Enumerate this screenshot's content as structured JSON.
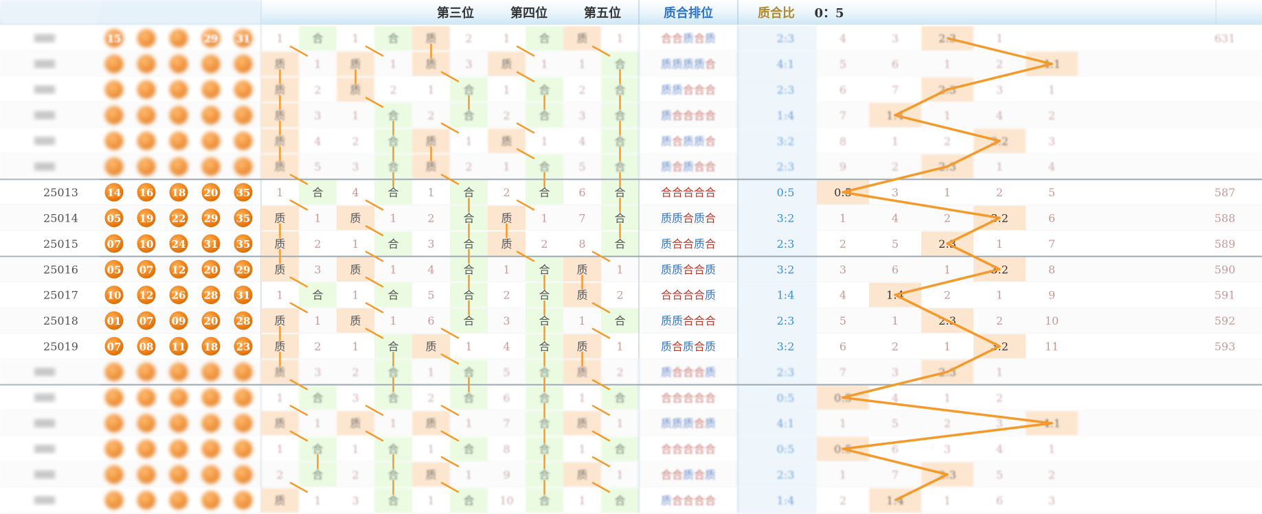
{
  "header": {
    "labels": [
      {
        "id": "col-pos3",
        "text": "第三位"
      },
      {
        "id": "col-pos4",
        "text": "第四位"
      },
      {
        "id": "col-pos5",
        "text": "第五位"
      },
      {
        "id": "col-order",
        "text": "质合排位"
      },
      {
        "id": "col-ratio",
        "text": "质合比"
      },
      {
        "id": "col-ratio-current",
        "text": "0：5"
      }
    ]
  },
  "colors": {
    "zhi_bg": "#fde6d0",
    "he_bg": "#eafbe2",
    "zhi_text": "#555555",
    "he_text": "#555555",
    "miss_text": "#c79a9a",
    "ratio_text": "#3a8fcc",
    "order_zhi": "#2f74c9",
    "order_he": "#c0392b",
    "ball": "#f0841c",
    "line": "#f39a2b",
    "pivot_bg": "#fde6d0"
  },
  "ratio_keys": [
    "0:5",
    "1:4",
    "2:3",
    "3:2",
    "4:1"
  ],
  "rows": [
    {
      "issue": "",
      "balls": [
        "15",
        "",
        "",
        "29",
        "31"
      ],
      "pos": [
        [
          "M",
          "1"
        ],
        [
          "H",
          ""
        ],
        [
          "M",
          "1"
        ],
        [
          "H",
          ""
        ],
        [
          "Z",
          ""
        ],
        [
          "M",
          "2"
        ],
        [
          "M",
          "1"
        ],
        [
          "H",
          ""
        ],
        [
          "Z",
          ""
        ],
        [
          "M",
          "1"
        ]
      ],
      "order": "合合质合质",
      "ratio": "2:3",
      "miss": [
        "4",
        "3",
        "2:3",
        "1",
        "",
        "631"
      ],
      "blur": "hard"
    },
    {
      "issue": "",
      "balls": [
        "",
        "",
        "",
        "",
        ""
      ],
      "pos": [
        [
          "Z",
          ""
        ],
        [
          "M",
          "1"
        ],
        [
          "Z",
          ""
        ],
        [
          "M",
          "1"
        ],
        [
          "Z",
          ""
        ],
        [
          "M",
          "3"
        ],
        [
          "Z",
          ""
        ],
        [
          "M",
          "1"
        ],
        [
          "M",
          "1"
        ],
        [
          "H",
          ""
        ]
      ],
      "order": "质质质质合",
      "ratio": "4:1",
      "miss": [
        "5",
        "6",
        "1",
        "2",
        "4:1",
        ""
      ],
      "blur": "hard"
    },
    {
      "issue": "",
      "balls": [
        "",
        "",
        "",
        "",
        ""
      ],
      "pos": [
        [
          "Z",
          ""
        ],
        [
          "M",
          "2"
        ],
        [
          "Z",
          ""
        ],
        [
          "M",
          "2"
        ],
        [
          "M",
          "1"
        ],
        [
          "H",
          ""
        ],
        [
          "M",
          "1"
        ],
        [
          "H",
          ""
        ],
        [
          "M",
          "2"
        ],
        [
          "H",
          ""
        ]
      ],
      "order": "质质合合合",
      "ratio": "2:3",
      "miss": [
        "6",
        "7",
        "2:3",
        "3",
        "1",
        ""
      ],
      "blur": "hard"
    },
    {
      "issue": "",
      "balls": [
        "",
        "",
        "",
        "",
        ""
      ],
      "pos": [
        [
          "Z",
          ""
        ],
        [
          "M",
          "3"
        ],
        [
          "M",
          "1"
        ],
        [
          "H",
          ""
        ],
        [
          "M",
          "2"
        ],
        [
          "H",
          ""
        ],
        [
          "M",
          "2"
        ],
        [
          "H",
          ""
        ],
        [
          "M",
          "3"
        ],
        [
          "H",
          ""
        ]
      ],
      "order": "质合合合合",
      "ratio": "1:4",
      "miss": [
        "7",
        "1:4",
        "1",
        "4",
        "2",
        ""
      ],
      "blur": "hard"
    },
    {
      "issue": "",
      "balls": [
        "",
        "",
        "",
        "",
        ""
      ],
      "pos": [
        [
          "Z",
          ""
        ],
        [
          "M",
          "4"
        ],
        [
          "M",
          "2"
        ],
        [
          "H",
          ""
        ],
        [
          "Z",
          ""
        ],
        [
          "M",
          "1"
        ],
        [
          "Z",
          ""
        ],
        [
          "M",
          "1"
        ],
        [
          "M",
          "4"
        ],
        [
          "H",
          ""
        ]
      ],
      "order": "质合质质合",
      "ratio": "3:2",
      "miss": [
        "8",
        "1",
        "2",
        "3:2",
        "3",
        ""
      ],
      "blur": "hard"
    },
    {
      "issue": "",
      "balls": [
        "",
        "",
        "",
        "",
        ""
      ],
      "pos": [
        [
          "Z",
          ""
        ],
        [
          "M",
          "5"
        ],
        [
          "M",
          "3"
        ],
        [
          "H",
          ""
        ],
        [
          "Z",
          ""
        ],
        [
          "M",
          "2"
        ],
        [
          "M",
          "1"
        ],
        [
          "H",
          ""
        ],
        [
          "M",
          "5"
        ],
        [
          "H",
          ""
        ]
      ],
      "order": "质合质合合",
      "ratio": "2:3",
      "miss": [
        "9",
        "2",
        "2:3",
        "1",
        "4",
        ""
      ],
      "blur": "hard"
    },
    {
      "issue": "25013",
      "balls": [
        "14",
        "16",
        "18",
        "20",
        "35"
      ],
      "pos": [
        [
          "M",
          "1"
        ],
        [
          "H",
          ""
        ],
        [
          "M",
          "4"
        ],
        [
          "H",
          ""
        ],
        [
          "M",
          "1"
        ],
        [
          "H",
          ""
        ],
        [
          "M",
          "2"
        ],
        [
          "H",
          ""
        ],
        [
          "M",
          "6"
        ],
        [
          "H",
          ""
        ]
      ],
      "order": "合合合合合",
      "ratio": "0:5",
      "miss": [
        "0:5",
        "3",
        "1",
        "2",
        "5",
        "587"
      ],
      "blur": ""
    },
    {
      "issue": "25014",
      "balls": [
        "05",
        "19",
        "22",
        "29",
        "35"
      ],
      "pos": [
        [
          "Z",
          ""
        ],
        [
          "M",
          "1"
        ],
        [
          "Z",
          ""
        ],
        [
          "M",
          "1"
        ],
        [
          "M",
          "2"
        ],
        [
          "H",
          ""
        ],
        [
          "Z",
          ""
        ],
        [
          "M",
          "1"
        ],
        [
          "M",
          "7"
        ],
        [
          "H",
          ""
        ]
      ],
      "order": "质质合质合",
      "ratio": "3:2",
      "miss": [
        "1",
        "4",
        "2",
        "3:2",
        "6",
        "588"
      ],
      "blur": ""
    },
    {
      "issue": "25015",
      "balls": [
        "07",
        "10",
        "24",
        "31",
        "35"
      ],
      "pos": [
        [
          "Z",
          ""
        ],
        [
          "M",
          "2"
        ],
        [
          "M",
          "1"
        ],
        [
          "H",
          ""
        ],
        [
          "M",
          "3"
        ],
        [
          "H",
          ""
        ],
        [
          "Z",
          ""
        ],
        [
          "M",
          "2"
        ],
        [
          "M",
          "8"
        ],
        [
          "H",
          ""
        ]
      ],
      "order": "质合合质合",
      "ratio": "2:3",
      "miss": [
        "2",
        "5",
        "2:3",
        "1",
        "7",
        "589"
      ],
      "blur": ""
    },
    {
      "issue": "25016",
      "balls": [
        "05",
        "07",
        "12",
        "20",
        "29"
      ],
      "pos": [
        [
          "Z",
          ""
        ],
        [
          "M",
          "3"
        ],
        [
          "Z",
          ""
        ],
        [
          "M",
          "1"
        ],
        [
          "M",
          "4"
        ],
        [
          "H",
          ""
        ],
        [
          "M",
          "1"
        ],
        [
          "H",
          ""
        ],
        [
          "Z",
          ""
        ],
        [
          "M",
          "1"
        ]
      ],
      "order": "质质合合质",
      "ratio": "3:2",
      "miss": [
        "3",
        "6",
        "1",
        "3:2",
        "8",
        "590"
      ],
      "blur": ""
    },
    {
      "issue": "25017",
      "balls": [
        "10",
        "12",
        "26",
        "28",
        "31"
      ],
      "pos": [
        [
          "M",
          "1"
        ],
        [
          "H",
          ""
        ],
        [
          "M",
          "1"
        ],
        [
          "H",
          ""
        ],
        [
          "M",
          "5"
        ],
        [
          "H",
          ""
        ],
        [
          "M",
          "2"
        ],
        [
          "H",
          ""
        ],
        [
          "Z",
          ""
        ],
        [
          "M",
          "2"
        ]
      ],
      "order": "合合合合质",
      "ratio": "1:4",
      "miss": [
        "4",
        "1:4",
        "2",
        "1",
        "9",
        "591"
      ],
      "blur": ""
    },
    {
      "issue": "25018",
      "balls": [
        "01",
        "07",
        "09",
        "20",
        "28"
      ],
      "pos": [
        [
          "Z",
          ""
        ],
        [
          "M",
          "1"
        ],
        [
          "Z",
          ""
        ],
        [
          "M",
          "1"
        ],
        [
          "M",
          "6"
        ],
        [
          "H",
          ""
        ],
        [
          "M",
          "3"
        ],
        [
          "H",
          ""
        ],
        [
          "M",
          "1"
        ],
        [
          "H",
          ""
        ]
      ],
      "order": "质质合合合",
      "ratio": "2:3",
      "miss": [
        "5",
        "1",
        "2:3",
        "2",
        "10",
        "592"
      ],
      "blur": ""
    },
    {
      "issue": "25019",
      "balls": [
        "07",
        "08",
        "11",
        "18",
        "23"
      ],
      "pos": [
        [
          "Z",
          ""
        ],
        [
          "M",
          "2"
        ],
        [
          "M",
          "1"
        ],
        [
          "H",
          ""
        ],
        [
          "Z",
          ""
        ],
        [
          "M",
          "1"
        ],
        [
          "M",
          "4"
        ],
        [
          "H",
          ""
        ],
        [
          "Z",
          ""
        ],
        [
          "M",
          "1"
        ]
      ],
      "order": "质合质合质",
      "ratio": "3:2",
      "miss": [
        "6",
        "2",
        "1",
        "3:2",
        "11",
        "593"
      ],
      "blur": ""
    },
    {
      "issue": "",
      "balls": [
        "",
        "",
        "",
        "",
        ""
      ],
      "pos": [
        [
          "Z",
          ""
        ],
        [
          "M",
          "3"
        ],
        [
          "M",
          "2"
        ],
        [
          "H",
          ""
        ],
        [
          "M",
          "1"
        ],
        [
          "H",
          ""
        ],
        [
          "M",
          "5"
        ],
        [
          "H",
          ""
        ],
        [
          "Z",
          ""
        ],
        [
          "M",
          "2"
        ]
      ],
      "order": "质合合合质",
      "ratio": "2:3",
      "miss": [
        "7",
        "3",
        "2:3",
        "1",
        "",
        ""
      ],
      "blur": "hard"
    },
    {
      "issue": "",
      "balls": [
        "",
        "",
        "",
        "",
        ""
      ],
      "pos": [
        [
          "M",
          "1"
        ],
        [
          "H",
          ""
        ],
        [
          "M",
          "3"
        ],
        [
          "H",
          ""
        ],
        [
          "M",
          "2"
        ],
        [
          "H",
          ""
        ],
        [
          "M",
          "6"
        ],
        [
          "H",
          ""
        ],
        [
          "M",
          "1"
        ],
        [
          "H",
          ""
        ]
      ],
      "order": "合合合合合",
      "ratio": "0:5",
      "miss": [
        "0:5",
        "4",
        "1",
        "2",
        "",
        ""
      ],
      "blur": "hard"
    },
    {
      "issue": "",
      "balls": [
        "",
        "",
        "",
        "",
        ""
      ],
      "pos": [
        [
          "Z",
          ""
        ],
        [
          "M",
          "1"
        ],
        [
          "Z",
          ""
        ],
        [
          "M",
          "1"
        ],
        [
          "Z",
          ""
        ],
        [
          "M",
          "1"
        ],
        [
          "M",
          "7"
        ],
        [
          "H",
          ""
        ],
        [
          "Z",
          ""
        ],
        [
          "M",
          "1"
        ]
      ],
      "order": "质质质合质",
      "ratio": "4:1",
      "miss": [
        "1",
        "5",
        "2",
        "3",
        "4:1",
        ""
      ],
      "blur": "hard"
    },
    {
      "issue": "",
      "balls": [
        "",
        "",
        "",
        "",
        ""
      ],
      "pos": [
        [
          "M",
          "1"
        ],
        [
          "H",
          ""
        ],
        [
          "M",
          "1"
        ],
        [
          "H",
          ""
        ],
        [
          "M",
          "1"
        ],
        [
          "H",
          ""
        ],
        [
          "M",
          "8"
        ],
        [
          "H",
          ""
        ],
        [
          "M",
          "1"
        ],
        [
          "H",
          ""
        ]
      ],
      "order": "合合合合合",
      "ratio": "0:5",
      "miss": [
        "0:5",
        "6",
        "3",
        "4",
        "1",
        ""
      ],
      "blur": "hard"
    },
    {
      "issue": "",
      "balls": [
        "",
        "",
        "",
        "",
        ""
      ],
      "pos": [
        [
          "M",
          "2"
        ],
        [
          "H",
          ""
        ],
        [
          "M",
          "2"
        ],
        [
          "H",
          ""
        ],
        [
          "Z",
          ""
        ],
        [
          "M",
          "1"
        ],
        [
          "M",
          "9"
        ],
        [
          "H",
          ""
        ],
        [
          "Z",
          ""
        ],
        [
          "M",
          "1"
        ]
      ],
      "order": "合合质合质",
      "ratio": "2:3",
      "miss": [
        "1",
        "7",
        "2:3",
        "5",
        "2",
        ""
      ],
      "blur": "hard"
    },
    {
      "issue": "",
      "balls": [
        "",
        "",
        "",
        "",
        ""
      ],
      "pos": [
        [
          "Z",
          ""
        ],
        [
          "M",
          "1"
        ],
        [
          "M",
          "3"
        ],
        [
          "H",
          ""
        ],
        [
          "M",
          "1"
        ],
        [
          "H",
          ""
        ],
        [
          "M",
          "10"
        ],
        [
          "H",
          ""
        ],
        [
          "M",
          "1"
        ],
        [
          "H",
          ""
        ]
      ],
      "order": "质合合合合",
      "ratio": "1:4",
      "miss": [
        "2",
        "1:4",
        "1",
        "6",
        "3",
        ""
      ],
      "blur": "hard"
    }
  ]
}
